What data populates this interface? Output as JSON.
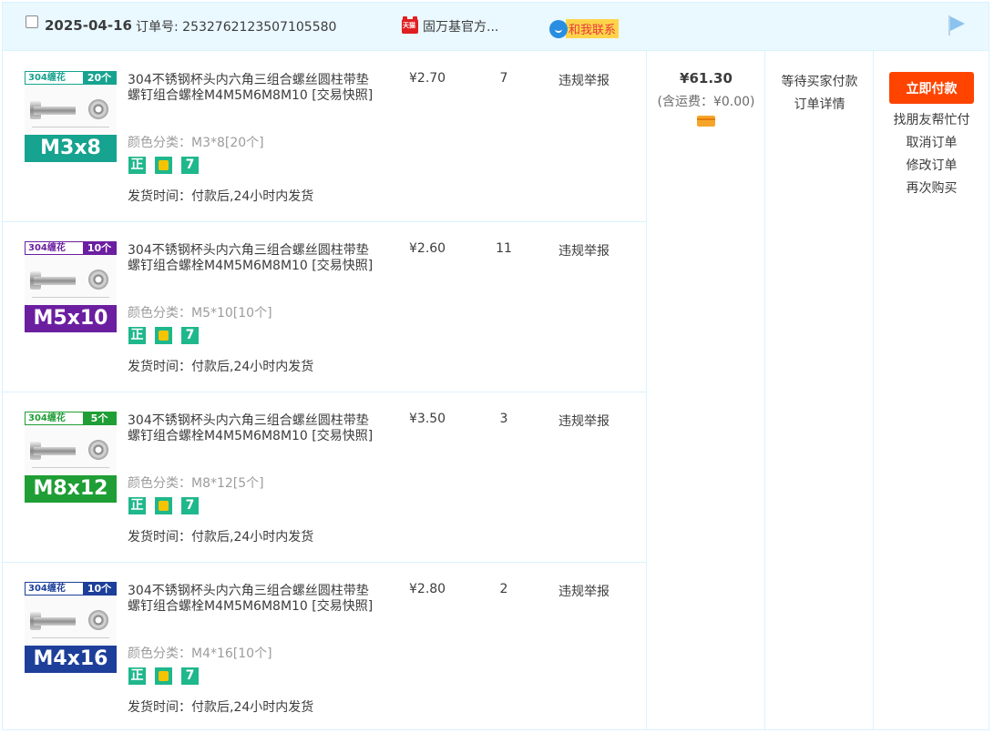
{
  "header": {
    "date": "2025-04-16",
    "order_label": "订单号:",
    "order_no": "2532762123507105580",
    "tmall_badge": "天猫",
    "shop_name": "固万基官方...",
    "contact_label": "和我联系",
    "icons": {
      "checkbox": "checkbox-icon",
      "flag": "flag-icon",
      "wangwang": "wangwang-chat-icon"
    }
  },
  "items": [
    {
      "thumb": {
        "brand": "304缠花",
        "count": "20个",
        "size": "M3x8",
        "color": "#16a38f"
      },
      "title": "304不锈钢杯头内六角三组合螺丝圆柱带垫螺钉组合螺栓M4M5M6M8M10 [交易快照]",
      "sku": "颜色分类：M3*8[20个]",
      "badges": [
        "正"
      ],
      "last_badge": "7",
      "ship": "发货时间：付款后,24小时内发货",
      "price": "¥2.70",
      "qty": "7",
      "report": "违规举报"
    },
    {
      "thumb": {
        "brand": "304缠花",
        "count": "10个",
        "size": "M5x10",
        "color": "#6b1fa0"
      },
      "title": "304不锈钢杯头内六角三组合螺丝圆柱带垫螺钉组合螺栓M4M5M6M8M10 [交易快照]",
      "sku": "颜色分类：M5*10[10个]",
      "badges": [
        "正"
      ],
      "last_badge": "7",
      "ship": "发货时间：付款后,24小时内发货",
      "price": "¥2.60",
      "qty": "11",
      "report": "违规举报"
    },
    {
      "thumb": {
        "brand": "304缠花",
        "count": "5个",
        "size": "M8x12",
        "color": "#1f9e35"
      },
      "title": "304不锈钢杯头内六角三组合螺丝圆柱带垫螺钉组合螺栓M4M5M6M8M10 [交易快照]",
      "sku": "颜色分类：M8*12[5个]",
      "badges": [
        "正"
      ],
      "last_badge": "7",
      "ship": "发货时间：付款后,24小时内发货",
      "price": "¥3.50",
      "qty": "3",
      "report": "违规举报"
    },
    {
      "thumb": {
        "brand": "304缠花",
        "count": "10个",
        "size": "M4x16",
        "color": "#1d3f9a"
      },
      "title": "304不锈钢杯头内六角三组合螺丝圆柱带垫螺钉组合螺栓M4M5M6M8M10 [交易快照]",
      "sku": "颜色分类：M4*16[10个]",
      "badges": [
        "正"
      ],
      "last_badge": "7",
      "ship": "发货时间：付款后,24小时内发货",
      "price": "¥2.80",
      "qty": "2",
      "report": "违规举报"
    }
  ],
  "summary": {
    "total": "¥61.30",
    "fee": "(含运费：¥0.00)",
    "status_1": "等待买家付款",
    "status_2": "订单详情",
    "pay_button": "立即付款",
    "op_1": "找朋友帮忙付",
    "op_2": "取消订单",
    "op_3": "修改订单",
    "op_4": "再次购买",
    "accent": "#ff4400"
  }
}
